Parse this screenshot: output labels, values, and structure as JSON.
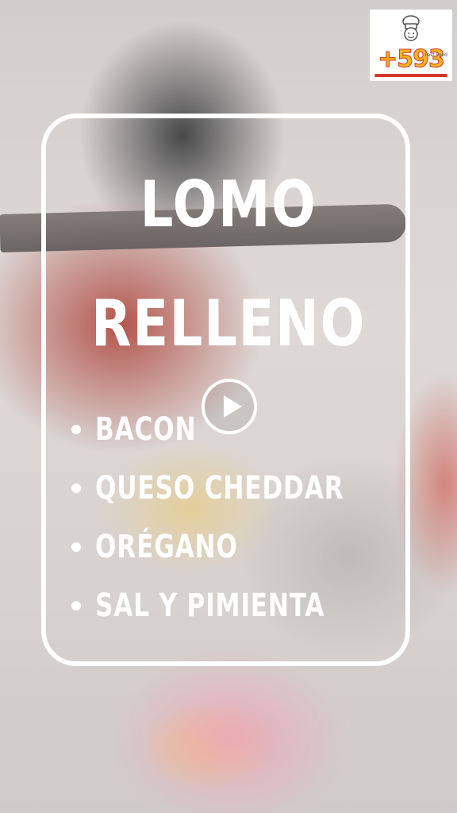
{
  "logo": {
    "brand": "+593",
    "tagline": "Fast Food"
  },
  "title": {
    "line1": "LOMO",
    "line2": "RELLENO"
  },
  "ingredients": [
    "BACON",
    "QUESO CHEDDAR",
    "ORÉGANO",
    "SAL Y PIMIENTA"
  ],
  "icons": {
    "play": "play-icon",
    "chef": "chef-hat-icon"
  },
  "colors": {
    "text": "#ffffff",
    "logo_yellow": "#f2b51c",
    "logo_red": "#d3382b"
  }
}
